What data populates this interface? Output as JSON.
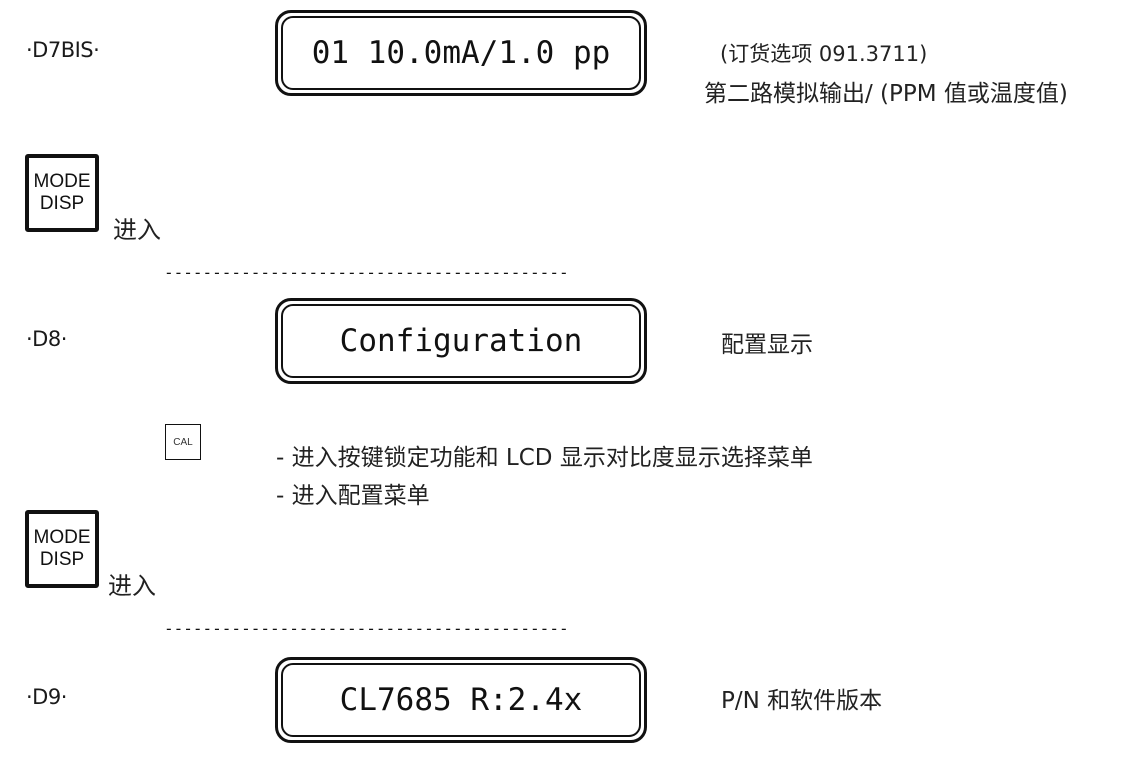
{
  "steps": [
    {
      "id": "D7BIS",
      "label": "·D7BIS·",
      "display": "01 10.0mA/1.0 pp",
      "notes": [
        "(订货选项 091.3711)",
        "第二路模拟输出/ (PPM 值或温度值)"
      ]
    },
    {
      "id": "D8",
      "label": "·D8·",
      "display": "Configuration",
      "notes": [
        "配置显示"
      ]
    },
    {
      "id": "D9",
      "label": "·D9·",
      "display": "CL7685 R:2.4x",
      "notes": [
        "P/N 和软件版本"
      ]
    }
  ],
  "keys": {
    "mode_disp_line1": "MODE",
    "mode_disp_line2": "DISP",
    "cal": "CAL",
    "enter_label": "进入"
  },
  "separator": "------------------------------------------",
  "cal_actions": [
    "- 进入按键锁定功能和 LCD 显示对比度显示选择菜单",
    "- 进入配置菜单"
  ]
}
